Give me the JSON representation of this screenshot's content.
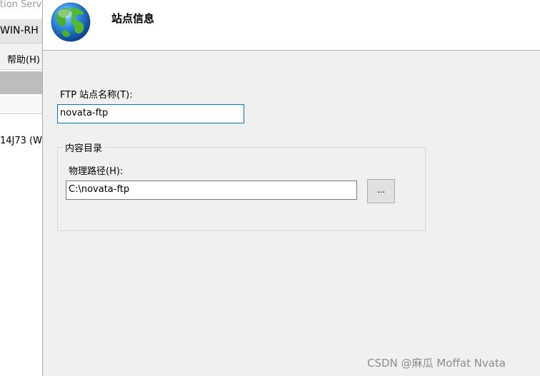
{
  "background_window": {
    "title_fragment": "tion Serv",
    "address_fragment": "WIN-RH",
    "menu_help": "帮助(H)",
    "tree_node_fragment": "14J73 (W"
  },
  "dialog": {
    "title": "站点信息",
    "site_name": {
      "label": "FTP 站点名称(T):",
      "value": "novata-ftp"
    },
    "content_directory": {
      "group_label": "内容目录",
      "path_label": "物理路径(H):",
      "path_value": "C:\\novata-ftp",
      "browse_label": "..."
    }
  },
  "watermark": "CSDN @麻瓜 Moffat Nvata"
}
